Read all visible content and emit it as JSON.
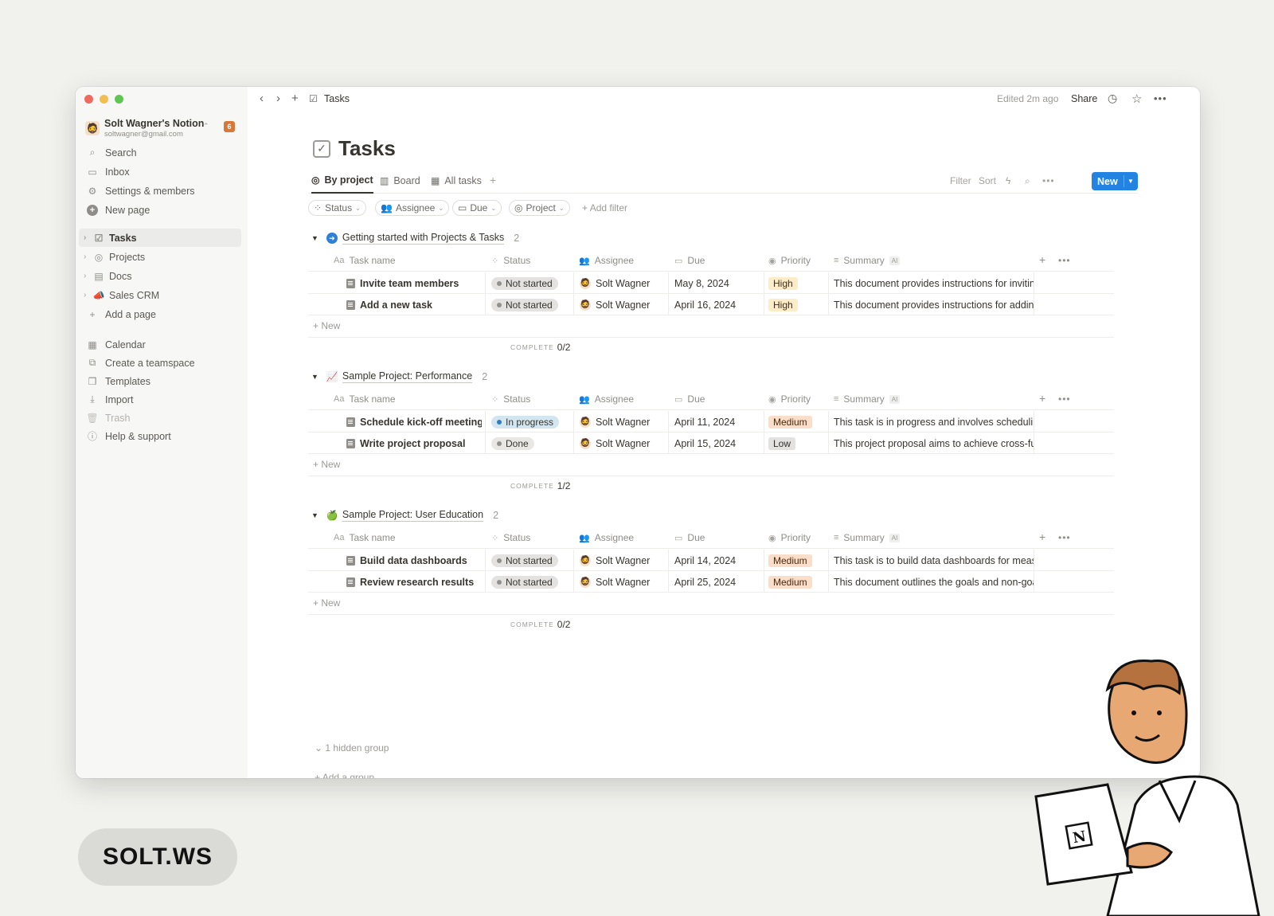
{
  "window": {
    "traffic_colors": [
      "#ec6a5e",
      "#f4be4f",
      "#61c554"
    ]
  },
  "sidebar": {
    "workspace_name": "Solt Wagner's Notion",
    "workspace_email": "soltwagner@gmail.com",
    "notification_count": "6",
    "top_items": [
      {
        "label": "Search",
        "icon": "search-icon"
      },
      {
        "label": "Inbox",
        "icon": "inbox-icon"
      },
      {
        "label": "Settings & members",
        "icon": "gear-icon"
      },
      {
        "label": "New page",
        "icon": "plus-circle-icon"
      }
    ],
    "pages": [
      {
        "label": "Tasks",
        "icon": "checkbox-icon"
      },
      {
        "label": "Projects",
        "icon": "target-icon"
      },
      {
        "label": "Docs",
        "icon": "document-icon"
      },
      {
        "label": "Sales CRM",
        "icon": "megaphone-icon"
      },
      {
        "label": "Add a page",
        "icon": "plus-icon"
      }
    ],
    "bottom_items": [
      {
        "label": "Calendar",
        "icon": "calendar-icon"
      },
      {
        "label": "Create a teamspace",
        "icon": "teamspace-icon"
      },
      {
        "label": "Templates",
        "icon": "templates-icon"
      },
      {
        "label": "Import",
        "icon": "download-icon"
      },
      {
        "label": "Trash",
        "icon": "trash-icon"
      },
      {
        "label": "Help & support",
        "icon": "help-icon"
      }
    ]
  },
  "topbar": {
    "breadcrumb": "Tasks",
    "edited": "Edited 2m ago",
    "share": "Share"
  },
  "page": {
    "title": "Tasks"
  },
  "views": {
    "tabs": [
      "By project",
      "Board",
      "All tasks"
    ],
    "filter": "Filter",
    "sort": "Sort",
    "new": "New"
  },
  "filters": {
    "chips": [
      "Status",
      "Assignee",
      "Due",
      "Project"
    ],
    "add_filter": "Add filter"
  },
  "columns": {
    "name": "Task name",
    "status": "Status",
    "assignee": "Assignee",
    "due": "Due",
    "priority": "Priority",
    "summary": "Summary",
    "ai_badge": "AI"
  },
  "groups": [
    {
      "title": "Getting started with Projects & Tasks",
      "count": "2",
      "icon_color": "#2f7fd6",
      "rows": [
        {
          "name": "Invite team members",
          "status": "Not started",
          "assignee": "Solt Wagner",
          "due": "May 8, 2024",
          "priority": "High",
          "summary": "This document provides instructions for inviting"
        },
        {
          "name": "Add a new task",
          "status": "Not started",
          "assignee": "Solt Wagner",
          "due": "April 16, 2024",
          "priority": "High",
          "summary": "This document provides instructions for adding"
        }
      ],
      "new": "New",
      "complete_label": "COMPLETE",
      "complete_value": "0/2"
    },
    {
      "title": "Sample Project: Performance",
      "count": "2",
      "icon_color": "#c0392b",
      "rows": [
        {
          "name": "Schedule kick-off meeting",
          "status": "In progress",
          "assignee": "Solt Wagner",
          "due": "April 11, 2024",
          "priority": "Medium",
          "summary": "This task is in progress and involves scheduling"
        },
        {
          "name": "Write project proposal",
          "status": "Done",
          "assignee": "Solt Wagner",
          "due": "April 15, 2024",
          "priority": "Low",
          "summary": "This project proposal aims to achieve cross-fur"
        }
      ],
      "new": "New",
      "complete_label": "COMPLETE",
      "complete_value": "1/2"
    },
    {
      "title": "Sample Project: User Education",
      "count": "2",
      "icon_color": "#4c9a2a",
      "rows": [
        {
          "name": "Build data dashboards",
          "status": "Not started",
          "assignee": "Solt Wagner",
          "due": "April 14, 2024",
          "priority": "Medium",
          "summary": "This task is to build data dashboards for measu"
        },
        {
          "name": "Review research results",
          "status": "Not started",
          "assignee": "Solt Wagner",
          "due": "April 25, 2024",
          "priority": "Medium",
          "summary": "This document outlines the goals and non-goal"
        }
      ],
      "new": "New",
      "complete_label": "COMPLETE",
      "complete_value": "0/2"
    }
  ],
  "hidden_group": "1 hidden group",
  "add_group": "Add a group",
  "brand": "SOLT.WS",
  "laptop_logo": "N"
}
